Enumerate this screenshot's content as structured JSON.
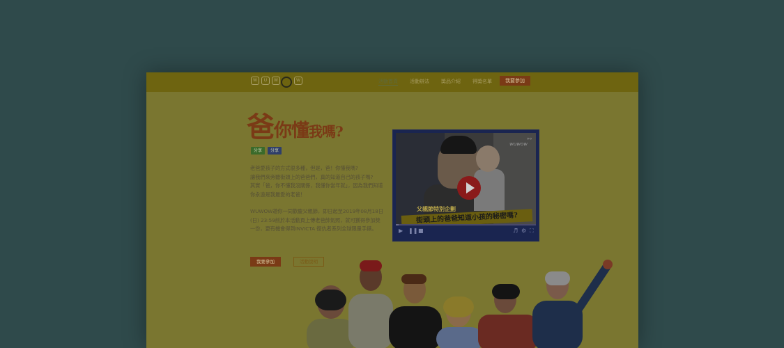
{
  "nav": {
    "items": [
      {
        "label": "活動首頁",
        "active": true
      },
      {
        "label": "活動辦法",
        "active": false
      },
      {
        "label": "獎品介紹",
        "active": false
      },
      {
        "label": "得獎名單",
        "active": false
      }
    ],
    "cta_label": "我要參加"
  },
  "logo": {
    "letters": [
      "W",
      "U",
      "W",
      "O",
      "W"
    ]
  },
  "hero": {
    "title_part1": "爸",
    "title_part2": "你懂",
    "title_part3": "我嗎?"
  },
  "share": {
    "line_label": "分享",
    "fb_label": "分享"
  },
  "intro": {
    "line1": "老爸愛孩子的方式很多種，但是，爸！你懂我嗎?",
    "line2": "讓我們來旁聽街頭上的爸爸們，真的知道自己的孩子嗎?",
    "line3": "其實「爸，你不懂我沒關係，我懂你當年就」，因為我們知道你永遠是我最愛的老爸！",
    "p2": "WUWOW邀你一同歡慶父親節，即日起至2019年08月18日(日) 23:59前於本活動頁上傳老爸帥氣照，就可獲得參加獎一份，更有機會得到INVICTA 復仇者系列全球限量手錶。"
  },
  "video": {
    "caption_top": "父親節特別企劃",
    "caption_main": "街頭上的爸爸知道小孩的秘密嗎?",
    "brand": "wuwow",
    "progress": 0.02
  },
  "buttons": {
    "join": "我要參加",
    "rules": "活動說明"
  },
  "colors": {
    "backdrop": "#2f4a4b",
    "page_bg": "#7a7630",
    "accent": "#7a3a16"
  }
}
